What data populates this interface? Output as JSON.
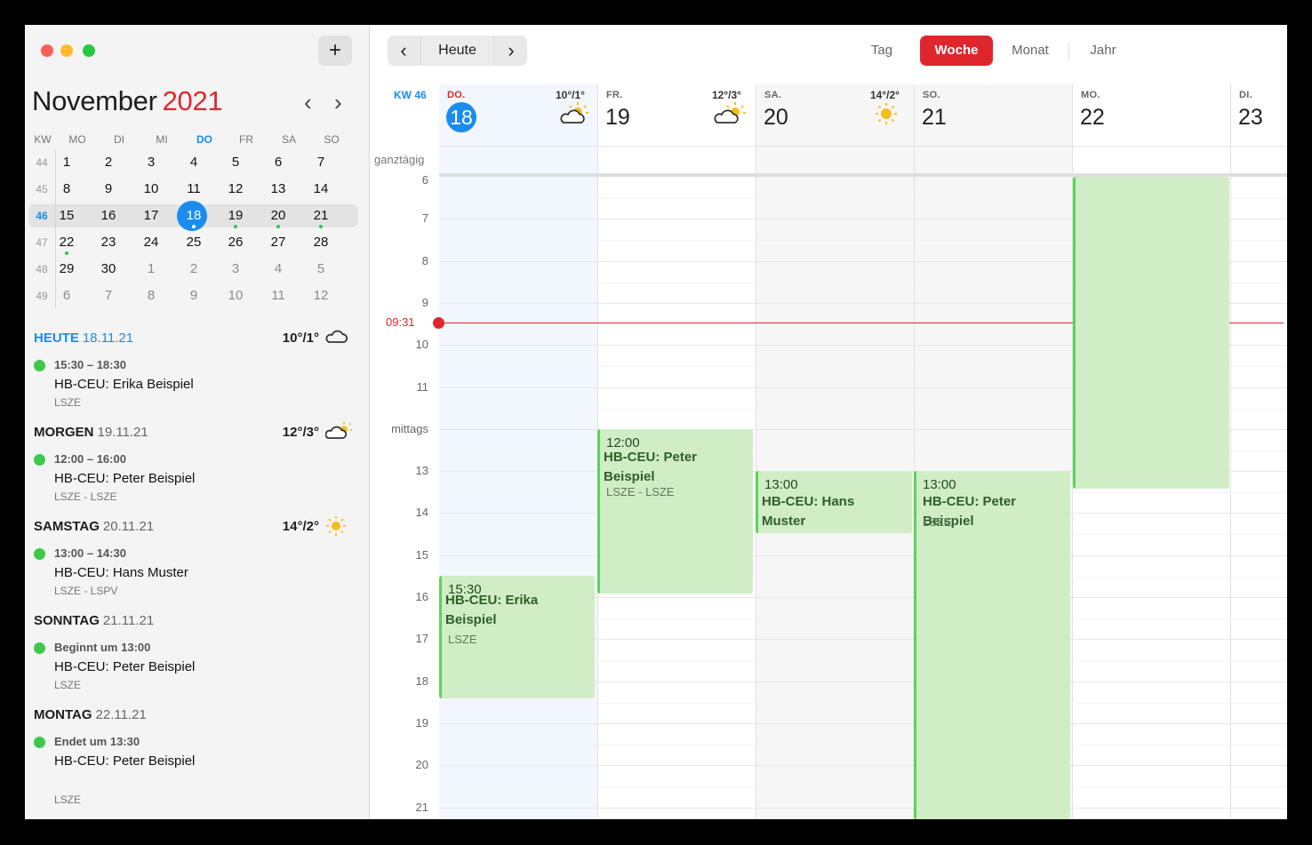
{
  "sidebar": {
    "add_label": "+",
    "month_name": "November",
    "year": "2021",
    "prev_icon": "‹",
    "next_icon": "›",
    "weekday_headers": [
      "KW",
      "MO",
      "DI",
      "MI",
      "DO",
      "FR",
      "SA",
      "SO"
    ],
    "weeks": [
      {
        "kw": "44",
        "days": [
          "1",
          "2",
          "3",
          "4",
          "5",
          "6",
          "7"
        ]
      },
      {
        "kw": "45",
        "days": [
          "8",
          "9",
          "10",
          "11",
          "12",
          "13",
          "14"
        ]
      },
      {
        "kw": "46",
        "days": [
          "15",
          "16",
          "17",
          "18",
          "19",
          "20",
          "21"
        ]
      },
      {
        "kw": "47",
        "days": [
          "22",
          "23",
          "24",
          "25",
          "26",
          "27",
          "28"
        ]
      },
      {
        "kw": "48",
        "days": [
          "29",
          "30",
          "1",
          "2",
          "3",
          "4",
          "5"
        ]
      },
      {
        "kw": "49",
        "days": [
          "6",
          "7",
          "8",
          "9",
          "10",
          "11",
          "12"
        ]
      }
    ],
    "agenda": [
      {
        "day": "HEUTE",
        "date": "18.11.21",
        "weather": "10°/1°",
        "weather_icon": "cloud-icon",
        "time": "15:30 – 18:30",
        "title": "HB-CEU: Erika Beispiel",
        "sub": "LSZE"
      },
      {
        "day": "MORGEN",
        "date": "19.11.21",
        "weather": "12°/3°",
        "weather_icon": "partly-sunny-icon",
        "time": "12:00 – 16:00",
        "title": "HB-CEU: Peter Beispiel",
        "sub": "LSZE - LSZE"
      },
      {
        "day": "SAMSTAG",
        "date": "20.11.21",
        "weather": "14°/2°",
        "weather_icon": "sun-icon",
        "time": "13:00 – 14:30",
        "title": "HB-CEU: Hans Muster",
        "sub": "LSZE - LSPV"
      },
      {
        "day": "SONNTAG",
        "date": "21.11.21",
        "weather": "",
        "time": "Beginnt um 13:00",
        "title": "HB-CEU: Peter Beispiel",
        "sub": "LSZE"
      },
      {
        "day": "MONTAG",
        "date": "22.11.21",
        "weather": "",
        "time": "Endet um 13:30",
        "title": "HB-CEU: Peter Beispiel",
        "sub": "LSZE"
      }
    ]
  },
  "toolbar": {
    "prev_icon": "‹",
    "today_label": "Heute",
    "next_icon": "›",
    "views": [
      "Tag",
      "Woche",
      "Monat",
      "Jahr"
    ],
    "active_view": "Woche"
  },
  "week": {
    "kw_label": "KW 46",
    "allday_label": "ganztägig",
    "days": [
      {
        "dow": "DO.",
        "dom": "18",
        "weather": "10°/1°",
        "weather_icon": "cloud-sun-icon"
      },
      {
        "dow": "FR.",
        "dom": "19",
        "weather": "12°/3°",
        "weather_icon": "cloud-sun-icon"
      },
      {
        "dow": "SA.",
        "dom": "20",
        "weather": "14°/2°",
        "weather_icon": "sun-icon"
      },
      {
        "dow": "SO.",
        "dom": "21",
        "weather": ""
      },
      {
        "dow": "MO.",
        "dom": "22",
        "weather": ""
      },
      {
        "dow": "DI.",
        "dom": "23",
        "weather": ""
      }
    ],
    "hour_labels": [
      "6",
      "7",
      "8",
      "9",
      "10",
      "11",
      "mittags",
      "13",
      "14",
      "15",
      "16",
      "17",
      "18",
      "19",
      "20",
      "21"
    ],
    "now_label": "09:31",
    "events": [
      {
        "time": "12:00",
        "title_1": "HB-CEU: Peter",
        "title_2": "Beispiel",
        "sub": "LSZE - LSZE"
      },
      {
        "time": "13:00",
        "title_1": "HB-CEU: Hans",
        "title_2": "Muster",
        "sub": ""
      },
      {
        "time": "13:00",
        "title_1": "HB-CEU: Peter Beispiel",
        "title_2": "",
        "sub": "LSZE"
      },
      {
        "time": "15:30",
        "title_1": "HB-CEU: Erika",
        "title_2": "Beispiel",
        "sub": "LSZE"
      }
    ]
  },
  "colors": {
    "accent_red": "#e0262d",
    "accent_blue": "#1a8cf0",
    "event_bg": "#d0edc6",
    "event_border": "#5bd35b"
  }
}
